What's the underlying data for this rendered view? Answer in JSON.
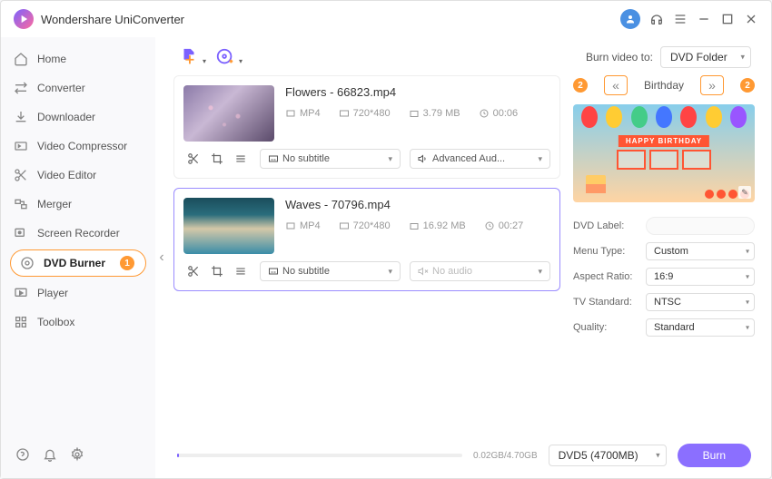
{
  "app_title": "Wondershare UniConverter",
  "sidebar": {
    "items": [
      {
        "label": "Home"
      },
      {
        "label": "Converter"
      },
      {
        "label": "Downloader"
      },
      {
        "label": "Video Compressor"
      },
      {
        "label": "Video Editor"
      },
      {
        "label": "Merger"
      },
      {
        "label": "Screen Recorder"
      },
      {
        "label": "DVD Burner",
        "badge": "1"
      },
      {
        "label": "Player"
      },
      {
        "label": "Toolbox"
      }
    ]
  },
  "toolbar": {
    "burn_to_label": "Burn video to:",
    "burn_to_value": "DVD Folder"
  },
  "videos": [
    {
      "title": "Flowers - 66823.mp4",
      "format": "MP4",
      "resolution": "720*480",
      "size": "3.79 MB",
      "duration": "00:06",
      "subtitle": "No subtitle",
      "audio": "Advanced Aud..."
    },
    {
      "title": "Waves - 70796.mp4",
      "format": "MP4",
      "resolution": "720*480",
      "size": "16.92 MB",
      "duration": "00:27",
      "subtitle": "No subtitle",
      "audio": "No audio"
    }
  ],
  "template": {
    "left_badge": "2",
    "right_badge": "2",
    "name": "Birthday",
    "banner": "HAPPY BIRTHDAY"
  },
  "settings": {
    "dvd_label_label": "DVD Label:",
    "dvd_label_value": "",
    "menu_type_label": "Menu Type:",
    "menu_type_value": "Custom",
    "aspect_ratio_label": "Aspect Ratio:",
    "aspect_ratio_value": "16:9",
    "tv_standard_label": "TV Standard:",
    "tv_standard_value": "NTSC",
    "quality_label": "Quality:",
    "quality_value": "Standard"
  },
  "footer": {
    "progress_text": "0.02GB/4.70GB",
    "disc_value": "DVD5 (4700MB)",
    "burn_label": "Burn"
  }
}
